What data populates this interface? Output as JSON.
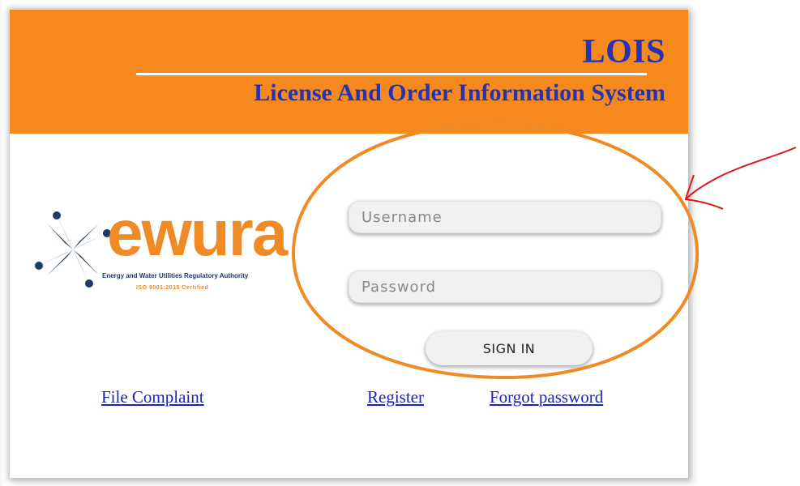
{
  "header": {
    "title": "LOIS",
    "subtitle": "License And Order Information System"
  },
  "logo": {
    "word": "ewura",
    "tagline": "Energy and Water Utilities Regulatory Authority",
    "certification": "ISO 9001:2015 Certified",
    "icon": "ewura-star-logo-icon"
  },
  "login": {
    "username_placeholder": "Username",
    "password_placeholder": "Password",
    "signin_label": "SIGN IN"
  },
  "links": {
    "file_complaint": "File Complaint",
    "register": "Register",
    "forgot_password": "Forgot password"
  },
  "colors": {
    "header_bg": "#f5891e",
    "title_text": "#2233b4",
    "link_text": "#1a24b8",
    "logo_orange": "#f08a24",
    "logo_navy": "#1f3a63",
    "annotation_ellipse": "#f08a24",
    "annotation_arrow": "#e0141e"
  }
}
